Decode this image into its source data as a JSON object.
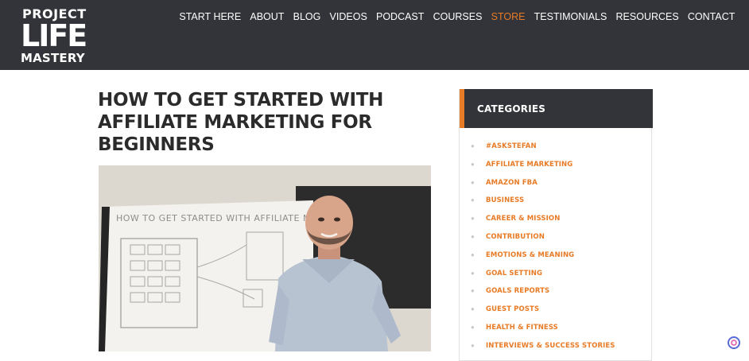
{
  "brand": {
    "logo_line1": "PROJECT",
    "logo_line2": "LIFE",
    "logo_line3": "MASTERY"
  },
  "nav": {
    "items": [
      {
        "label": "START HERE"
      },
      {
        "label": "ABOUT"
      },
      {
        "label": "BLOG"
      },
      {
        "label": "VIDEOS"
      },
      {
        "label": "PODCAST"
      },
      {
        "label": "COURSES"
      },
      {
        "label": "STORE",
        "active": true
      },
      {
        "label": "TESTIMONIALS"
      },
      {
        "label": "RESOURCES"
      },
      {
        "label": "CONTACT"
      }
    ]
  },
  "article": {
    "title": "HOW TO GET STARTED WITH AFFILIATE MARKETING FOR BEGINNERS",
    "whiteboard_text": "HOW TO GET STARTED WITH AFFILIATE MA"
  },
  "sidebar": {
    "heading": "CATEGORIES",
    "categories": [
      "#ASKSTEFAN",
      "AFFILIATE MARKETING",
      "AMAZON FBA",
      "BUSINESS",
      "CAREER & MISSION",
      "CONTRIBUTION",
      "EMOTIONS & MEANING",
      "GOAL SETTING",
      "GOALS REPORTS",
      "GUEST POSTS",
      "HEALTH & FITNESS",
      "INTERVIEWS & SUCCESS STORIES"
    ]
  },
  "colors": {
    "header_bg": "#323439",
    "accent": "#e87b26",
    "title_text": "#2b2b2b"
  },
  "icons": {
    "corner": "chat-bubble-icon"
  }
}
